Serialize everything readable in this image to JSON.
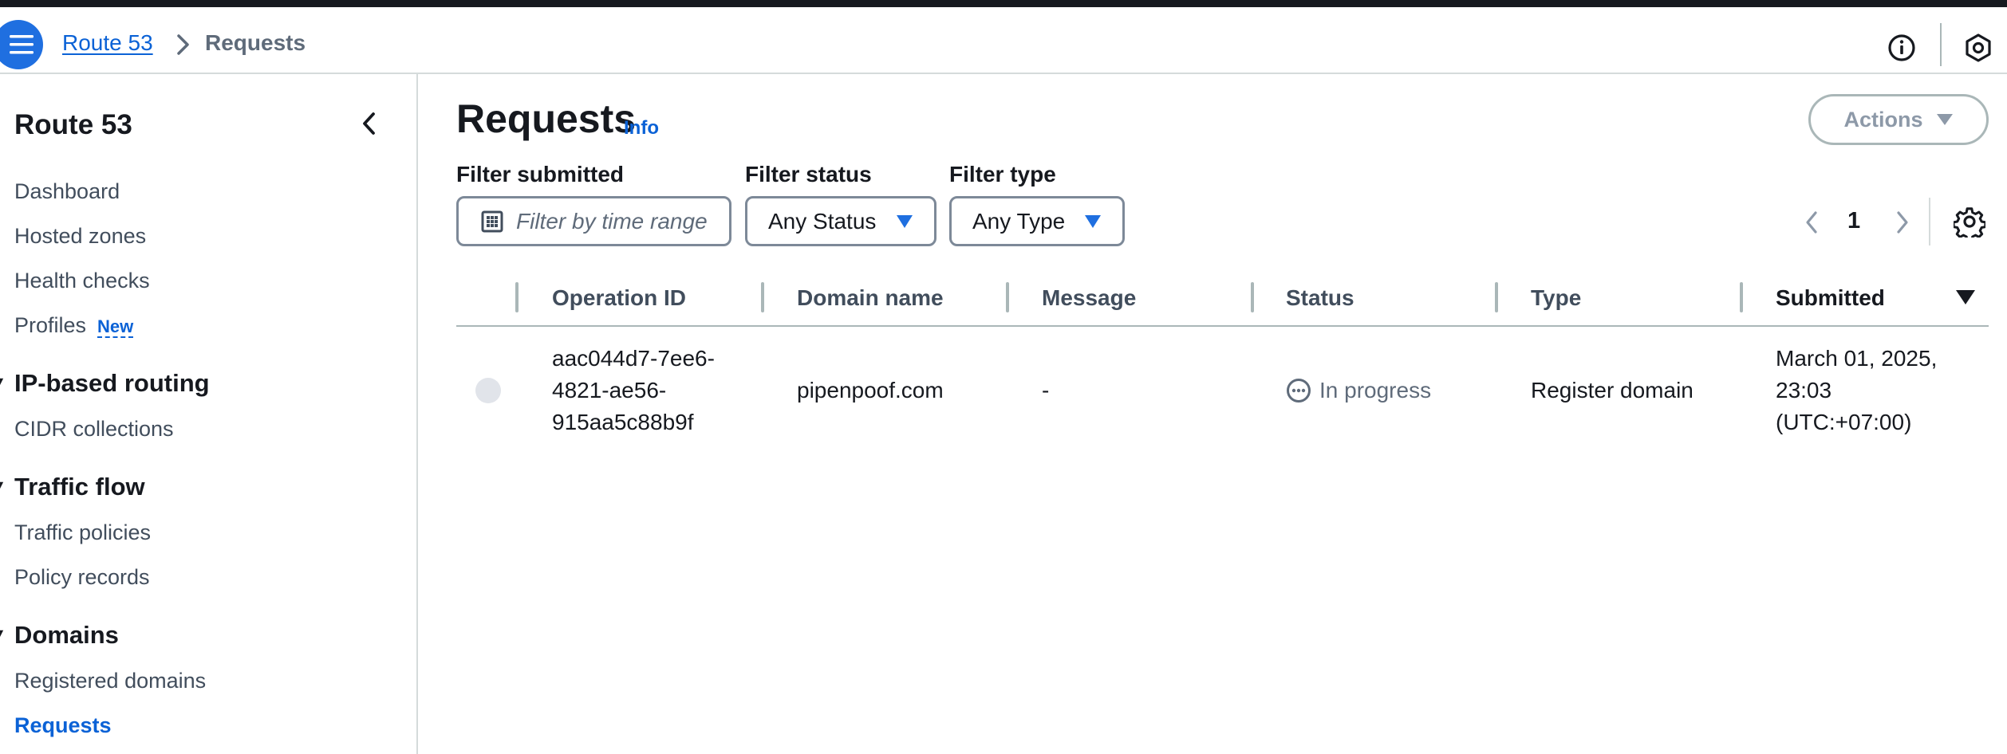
{
  "header": {
    "breadcrumb_root": "Route 53",
    "breadcrumb_current": "Requests"
  },
  "sidebar": {
    "title": "Route 53",
    "items": [
      {
        "label": "Dashboard"
      },
      {
        "label": "Hosted zones"
      },
      {
        "label": "Health checks"
      },
      {
        "label": "Profiles",
        "badge": "New"
      }
    ],
    "sections": [
      {
        "title": "IP-based routing",
        "items": [
          {
            "label": "CIDR collections"
          }
        ]
      },
      {
        "title": "Traffic flow",
        "items": [
          {
            "label": "Traffic policies"
          },
          {
            "label": "Policy records"
          }
        ]
      },
      {
        "title": "Domains",
        "items": [
          {
            "label": "Registered domains"
          },
          {
            "label": "Requests",
            "active": true
          }
        ]
      }
    ]
  },
  "main": {
    "title": "Requests",
    "info_link": "Info",
    "actions_label": "Actions",
    "filters": {
      "submitted_label": "Filter submitted",
      "submitted_placeholder": "Filter by time range",
      "status_label": "Filter status",
      "status_value": "Any Status",
      "type_label": "Filter type",
      "type_value": "Any Type"
    },
    "pagination": {
      "current_page": "1"
    },
    "table": {
      "columns": [
        "Operation ID",
        "Domain name",
        "Message",
        "Status",
        "Type",
        "Submitted"
      ],
      "rows": [
        {
          "operation_id": [
            "aac044d7-7ee6-",
            "4821-ae56-",
            "915aa5c88b9f"
          ],
          "domain_name": "pipenpoof.com",
          "message": "-",
          "status": "In progress",
          "type": "Register domain",
          "submitted": [
            "March 01, 2025,",
            "23:03",
            "(UTC:+07:00)"
          ]
        }
      ]
    }
  },
  "colors": {
    "accent": "#0b62d6",
    "menu_button": "#1f6fe0",
    "border": "#7d8998",
    "muted_text": "#5f6b7a"
  }
}
